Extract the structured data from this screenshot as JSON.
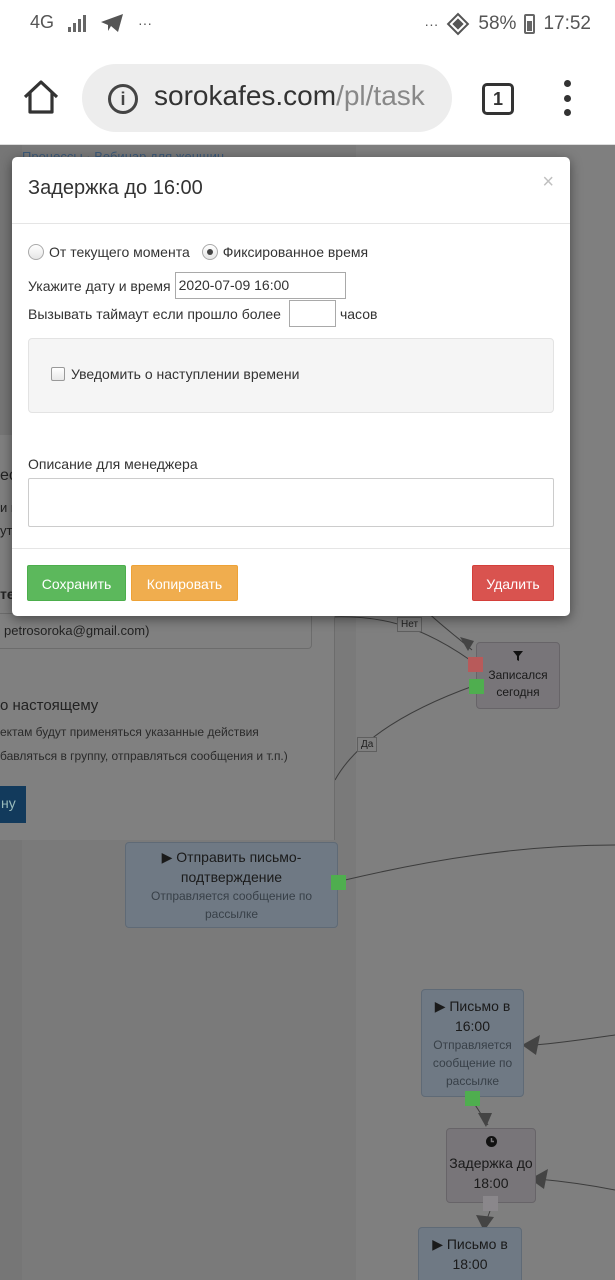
{
  "status_bar": {
    "network": "4G",
    "more": "···",
    "more_right": "···",
    "battery": "58%",
    "time": "17:52"
  },
  "browser": {
    "url_domain": "sorokafes.com",
    "url_path": "/pl/task",
    "tab_count": "1"
  },
  "background": {
    "breadcrumb": "Процессы · Вебинар для женщин",
    "frag_1": "ес",
    "frag_2": "и п",
    "frag_3": "ут",
    "frag_4": "те",
    "email": "petrosoroka@gmail.com)",
    "heading": "о настоящему",
    "line_1": "ектам будут применяться указанные действия",
    "line_2": "бавляться в группу, отправляться сообщения и т.п.)",
    "button_fragment": "ну",
    "edge_no": "Нет",
    "edge_yes": "Да",
    "nodes": [
      {
        "title": "Записался сегодня"
      },
      {
        "title": "▶ Отправить письмо-подтверждение",
        "subtitle": "Отправляется сообщение по рассылке"
      },
      {
        "title": "▶ Письмо в 16:00",
        "subtitle": "Отправляется сообщение по рассылке"
      },
      {
        "title": "Задержка до 18:00"
      },
      {
        "title": "▶ Письмо в 18:00"
      }
    ]
  },
  "modal": {
    "title": "Задержка до 16:00",
    "close": "×",
    "radio_current": "От текущего момента",
    "radio_fixed": "Фиксированное время",
    "date_label": "Укажите дату и время",
    "date_value": "2020-07-09 16:00",
    "timeout_label": "Вызывать таймаут если прошло более",
    "timeout_unit": "часов",
    "timeout_value": "",
    "notify_label": "Уведомить о наступлении времени",
    "description_label": "Описание для менеджера",
    "save_label": "Сохранить",
    "copy_label": "Копировать",
    "delete_label": "Удалить"
  },
  "colors": {
    "save": "#5cb85c",
    "copy": "#f0ad4e",
    "delete": "#d9534f",
    "port_green": "#4fae4f",
    "port_red": "#b85a5a"
  }
}
